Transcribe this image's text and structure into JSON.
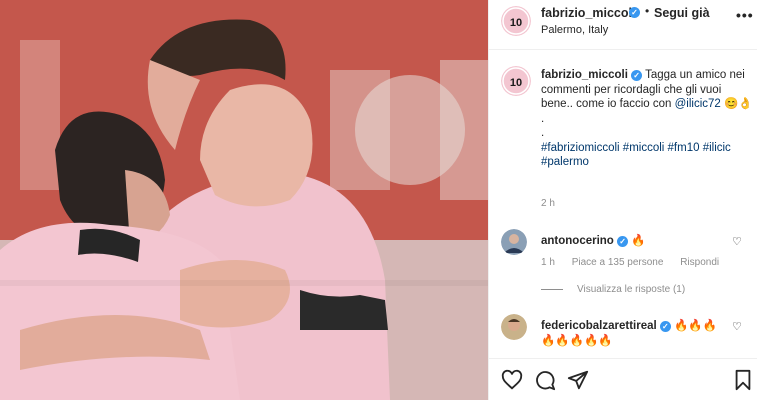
{
  "post": {
    "username": "fabrizio_miccoli",
    "follow_label": "Segui già",
    "location": "Palermo, Italy",
    "more_icon": "more-horizontal-icon"
  },
  "caption": {
    "username": "fabrizio_miccoli",
    "text": "Tagga un amico nei commenti per ricordagli che gli vuoi bene.. come io faccio con",
    "mention": "@ilicic72",
    "emoji": "😊👌",
    "dot1": ".",
    "dot2": ".",
    "hashtags": "#fabriziomiccoli #miccoli #fm10 #ilicic #palermo",
    "time": "2 h"
  },
  "comments": [
    {
      "username": "antonocerino",
      "text": "🔥",
      "time": "1 h",
      "likes": "Piace a 135 persone",
      "reply": "Rispondi"
    },
    {
      "username": "federicobalzarettireal",
      "text": "🔥🔥🔥",
      "text2": "🔥🔥🔥🔥🔥"
    }
  ],
  "view_replies": "Visualizza le risposte (1)",
  "actions": [
    "heart-icon",
    "comment-icon",
    "share-icon",
    "bookmark-icon"
  ],
  "colors": {
    "verified": "#3897f0",
    "link": "#00376b",
    "muted": "#8e8e8e"
  }
}
